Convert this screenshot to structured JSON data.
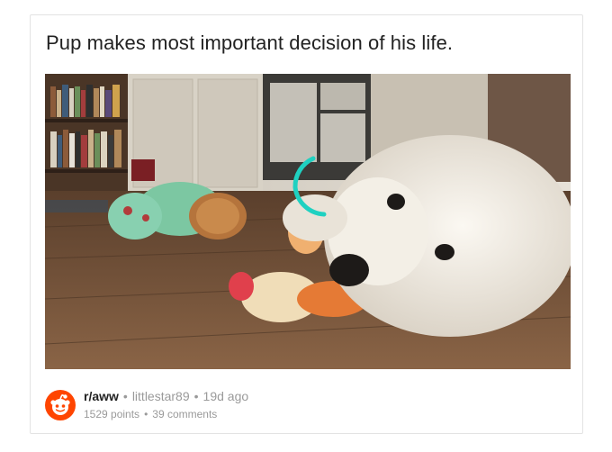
{
  "post": {
    "title": "Pup makes most important decision of his life.",
    "subreddit": "r/aww",
    "author": "littlestar89",
    "age": "19d ago",
    "points": "1529 points",
    "comments": "39 comments",
    "separator": "•"
  },
  "media": {
    "type": "video",
    "loading": true,
    "spinner_color": "#1fd1c1"
  },
  "icons": {
    "avatar": "reddit-alien-icon",
    "avatar_color": "#ff4500"
  }
}
